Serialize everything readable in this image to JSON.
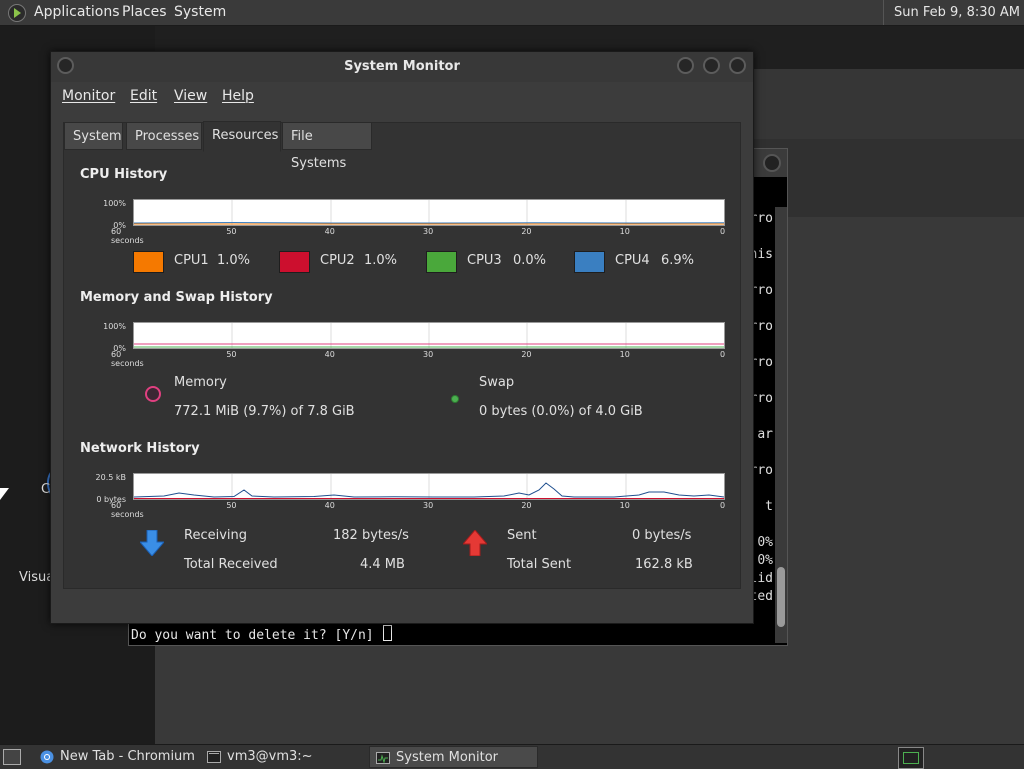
{
  "top_panel": {
    "menus": [
      "Applications",
      "Places",
      "System"
    ],
    "clock": "Sun Feb 9, 8:30 AM"
  },
  "desktop": {
    "labels": [
      "C",
      "Visua"
    ]
  },
  "terminal": {
    "fragments": [
      "rro",
      "his",
      "rro",
      "rro",
      "rro",
      "rro",
      "ar",
      "rro",
      "t",
      "0%",
      "0%",
      "lid",
      "ted"
    ],
    "prompt": "Do you want to delete it? [Y/n] "
  },
  "sysmon": {
    "title": "System Monitor",
    "menu": [
      "Monitor",
      "Edit",
      "View",
      "Help"
    ],
    "tabs": [
      "System",
      "Processes",
      "Resources",
      "File Systems"
    ],
    "active_tab": "Resources",
    "x_ticks": [
      "60 seconds",
      "50",
      "40",
      "30",
      "20",
      "10",
      "0"
    ],
    "cpu": {
      "title": "CPU History",
      "y_ticks": [
        "100%",
        "0%"
      ],
      "series": [
        {
          "name": "CPU1",
          "value": "1.0%",
          "color": "#f57900"
        },
        {
          "name": "CPU2",
          "value": "1.0%",
          "color": "#cc0f2e"
        },
        {
          "name": "CPU3",
          "value": "0.0%",
          "color": "#4aa83b"
        },
        {
          "name": "CPU4",
          "value": "6.9%",
          "color": "#3a7fc1"
        }
      ]
    },
    "memory": {
      "title": "Memory and Swap History",
      "y_ticks": [
        "100%",
        "0%"
      ],
      "memory_label": "Memory",
      "memory_value": "772.1 MiB (9.7%) of 7.8 GiB",
      "memory_color": "#e04080",
      "swap_label": "Swap",
      "swap_value": "0 bytes (0.0%) of 4.0 GiB",
      "swap_color": "#4caf50"
    },
    "network": {
      "title": "Network History",
      "y_ticks": [
        "20.5 kB",
        "0 bytes"
      ],
      "receiving_label": "Receiving",
      "receiving_rate": "182 bytes/s",
      "total_received_label": "Total Received",
      "total_received": "4.4 MB",
      "sent_label": "Sent",
      "sent_rate": "0 bytes/s",
      "total_sent_label": "Total Sent",
      "total_sent": "162.8 kB"
    }
  },
  "taskbar": {
    "tasks": [
      {
        "label": "New Tab - Chromium",
        "icon": "chromium-icon",
        "active": false
      },
      {
        "label": "vm3@vm3:~",
        "icon": "terminal-icon",
        "active": false
      },
      {
        "label": "System Monitor",
        "icon": "system-monitor-icon",
        "active": true
      }
    ]
  }
}
